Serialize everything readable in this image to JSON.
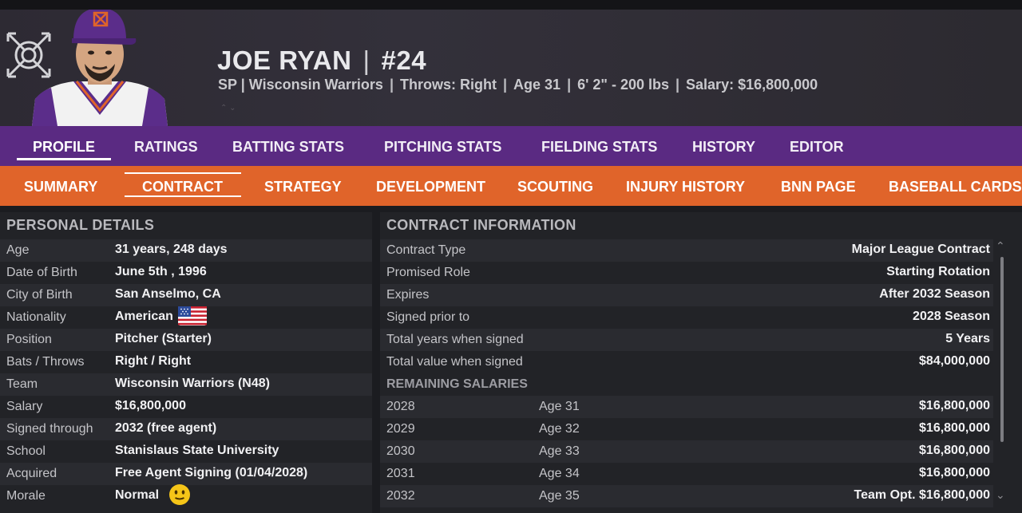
{
  "player": {
    "name": "JOE RYAN",
    "number": "#24",
    "position": "SP",
    "team": "Wisconsin Warriors",
    "throws": "Throws: Right",
    "age": "Age 31",
    "height_weight": "6' 2\"  - 200 lbs",
    "salary": "Salary: $16,800,000"
  },
  "nav_primary": [
    "PROFILE",
    "RATINGS",
    "BATTING STATS",
    "PITCHING STATS",
    "FIELDING STATS",
    "HISTORY",
    "EDITOR"
  ],
  "nav_primary_active": "PROFILE",
  "nav_secondary": [
    "SUMMARY",
    "CONTRACT",
    "STRATEGY",
    "DEVELOPMENT",
    "SCOUTING",
    "INJURY HISTORY",
    "BNN PAGE",
    "BASEBALL CARDS"
  ],
  "nav_secondary_active": "CONTRACT",
  "personal": {
    "title": "PERSONAL DETAILS",
    "rows": [
      {
        "label": "Age",
        "value": "31 years, 248 days"
      },
      {
        "label": "Date of Birth",
        "value": "June 5th , 1996"
      },
      {
        "label": "City of Birth",
        "value": "San Anselmo, CA"
      },
      {
        "label": "Nationality",
        "value": "American"
      },
      {
        "label": "Position",
        "value": "Pitcher (Starter)"
      },
      {
        "label": "Bats / Throws",
        "value": "Right / Right"
      },
      {
        "label": "Team",
        "value": "Wisconsin Warriors (N48)"
      },
      {
        "label": "Salary",
        "value": "$16,800,000"
      },
      {
        "label": "Signed through",
        "value": "2032 (free agent)"
      },
      {
        "label": "School",
        "value": "Stanislaus State University"
      },
      {
        "label": "Acquired",
        "value": "Free Agent Signing (01/04/2028)"
      },
      {
        "label": "Morale",
        "value": "Normal"
      }
    ]
  },
  "contract": {
    "title": "CONTRACT INFORMATION",
    "rows": [
      {
        "label": "Contract Type",
        "value": "Major League Contract"
      },
      {
        "label": "Promised Role",
        "value": "Starting Rotation"
      },
      {
        "label": "Expires",
        "value": "After 2032 Season"
      },
      {
        "label": "Signed prior to",
        "value": "2028 Season"
      },
      {
        "label": "Total years when signed",
        "value": "5 Years"
      },
      {
        "label": "Total value when signed",
        "value": "$84,000,000"
      }
    ],
    "remaining_title": "REMAINING SALARIES",
    "salaries": [
      {
        "year": "2028",
        "age": "Age 31",
        "amount": "$16,800,000"
      },
      {
        "year": "2029",
        "age": "Age 32",
        "amount": "$16,800,000"
      },
      {
        "year": "2030",
        "age": "Age 33",
        "amount": "$16,800,000"
      },
      {
        "year": "2031",
        "age": "Age 34",
        "amount": "$16,800,000"
      },
      {
        "year": "2032",
        "age": "Age 35",
        "amount": "Team Opt. $16,800,000"
      }
    ]
  },
  "colors": {
    "nav_primary_bg": "#5a2a82",
    "nav_secondary_bg": "#e0642a"
  },
  "icons": {
    "team_logo": "warriors-shield-icon",
    "flag": "us-flag-icon",
    "morale": "smiley-icon",
    "scroll_up": "chevron-up-icon",
    "scroll_down": "chevron-down-icon"
  }
}
